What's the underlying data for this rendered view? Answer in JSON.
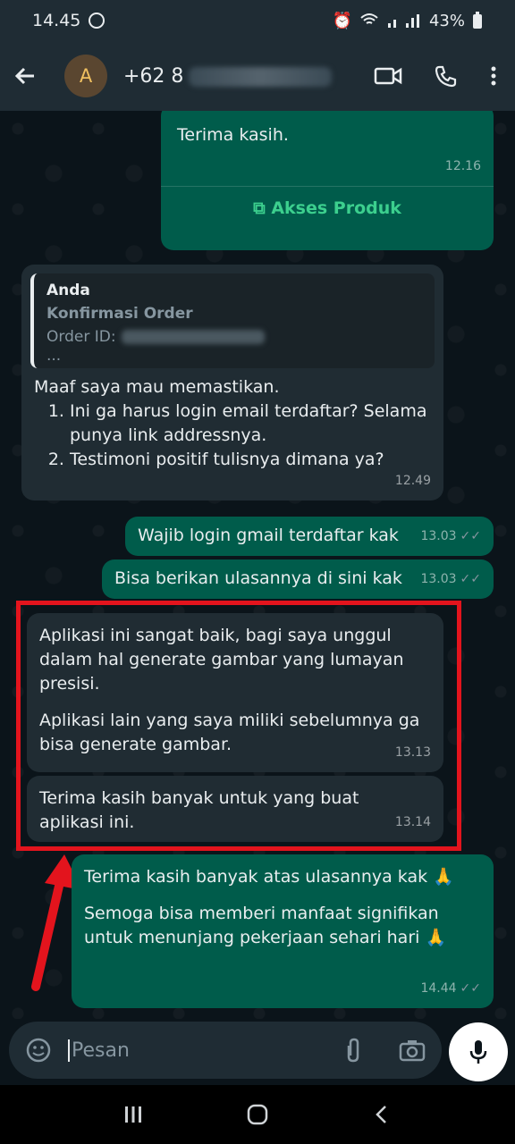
{
  "status_bar": {
    "time": "14.45",
    "battery": "43%"
  },
  "header": {
    "avatar_letter": "A",
    "contact_prefix": "+62 8"
  },
  "messages": {
    "m1": {
      "text": "Terima kasih.",
      "time": "12.16",
      "action": "Akses Produk"
    },
    "m2": {
      "quote_author": "Anda",
      "quote_title": "Konfirmasi Order",
      "quote_order_label": "Order ID:",
      "quote_more": "...",
      "text": "Maaf saya mau memastikan.",
      "items": [
        "Ini ga harus login email terdaftar? Selama punya link addressnya.",
        "Testimoni positif tulisnya dimana ya?"
      ],
      "time": "12.49"
    },
    "m3": {
      "text": "Wajib login gmail terdaftar kak",
      "time": "13.03"
    },
    "m4": {
      "text": "Bisa berikan ulasannya di sini kak",
      "time": "13.03"
    },
    "m5": {
      "p1": "Aplikasi ini sangat baik, bagi saya unggul dalam hal generate gambar yang lumayan presisi.",
      "p2": "Aplikasi lain yang saya miliki sebelumnya ga bisa generate gambar.",
      "time": "13.13"
    },
    "m6": {
      "text": "Terima kasih banyak untuk yang buat aplikasi ini.",
      "time": "13.14"
    },
    "m7": {
      "p1": "Terima kasih banyak atas ulasannya kak 🙏",
      "p2": "Semoga bisa memberi manfaat signifikan untuk menunjang pekerjaan sehari hari 🙏",
      "time": "14.44"
    }
  },
  "composer": {
    "placeholder": "Pesan"
  },
  "colors": {
    "highlight": "#e3141d",
    "outgoing": "#005c4b",
    "incoming": "#202c33"
  }
}
